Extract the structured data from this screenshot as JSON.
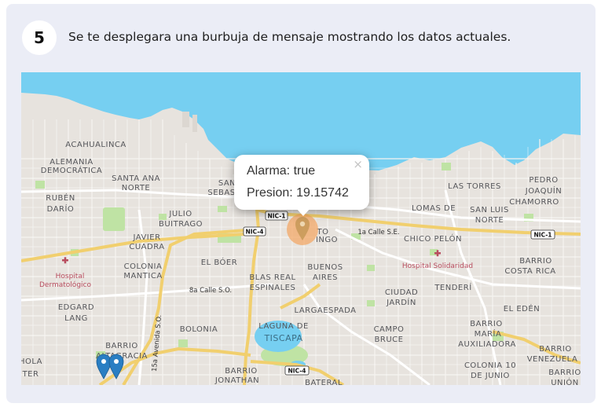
{
  "step": {
    "number": "5",
    "text": "Se te desplegara una burbuja de mensaje mostrando los datos actuales."
  },
  "popup": {
    "close": "×",
    "line1": "Alarma: true",
    "line2": "Presion: 19.15742"
  },
  "map": {
    "labels": {
      "acahualinca": "ACAHUALINCA",
      "alemania1": "ALEMANIA",
      "alemania2": "DEMOCRÁTICA",
      "santa_ana1": "SANTA ANA",
      "santa_ana2": "NORTE",
      "ruben1": "RUBÉN",
      "ruben2": "DARÍO",
      "julio1": "JULIO",
      "julio2": "BUITRAGO",
      "javier1": "JAVIER",
      "javier2": "CUADRA",
      "colonia1": "COLONIA",
      "colonia2": "MANTICA",
      "el_boer": "EL BÓER",
      "hospital1_1": "Hospital",
      "hospital1_2": "Dermatológico",
      "edgard1": "EDGARD",
      "edgard2": "LANG",
      "bolonia": "BOLONIA",
      "barrio_ac1": "BARRIO",
      "barrio_ac2": "ALTAGRACIA",
      "hola": "HOLA",
      "ter": "TER",
      "blas1": "BLAS REAL",
      "blas2": "ESPINALES",
      "buenos1": "BUENOS",
      "buenos2": "AIRES",
      "largaespada": "LARGAESPADA",
      "laguna1": "LAGUNA DE",
      "laguna2": "TISCAPA",
      "campo1": "CAMPO",
      "campo2": "BRUCE",
      "barrio_jon1": "BARRIO",
      "barrio_jon2": "JONATHAN",
      "ciudad1": "CIUDAD",
      "ciudad2": "JARDÍN",
      "las_torres": "LAS TORRES",
      "pedro1": "PEDRO",
      "pedro2": "JOAQUÍN",
      "pedro3": "CHAMORRO",
      "san_luis1": "SAN LUIS",
      "san_luis2": "NORTE",
      "lomas1": "LOMAS DE",
      "lomas2": "CHICO PELÓN",
      "hospital2": "Hospital Solidaridad",
      "tenderi": "TENDERÍ",
      "barrio_cr1": "BARRIO",
      "barrio_cr2": "COSTA RICA",
      "el_eden": "EL EDÉN",
      "barrio_ma1": "BARRIO",
      "barrio_ma2": "MARÍA",
      "barrio_ma3": "AUXILIADORA",
      "barrio_ve1": "BARRIO",
      "barrio_ve2": "VENEZUELA",
      "colonia10_1": "COLONIA 10",
      "colonia10_2": "DE JUNIO",
      "barrio_un1": "BARRIO",
      "barrio_un2": "UNIÓN",
      "san_seb1": "SAN",
      "san_seb2": "SEBAS",
      "to": "TO",
      "ingo": "INGO",
      "batera": "BATERAL",
      "street_1a": "1a Calle S.E.",
      "street_8a": "8a Calle S.O.",
      "street_15a": "15a Avenida S.O.",
      "nic1_a": "NIC-1",
      "nic1_b": "NIC-1",
      "nic4_a": "NIC-4",
      "nic4_b": "NIC-4"
    }
  }
}
